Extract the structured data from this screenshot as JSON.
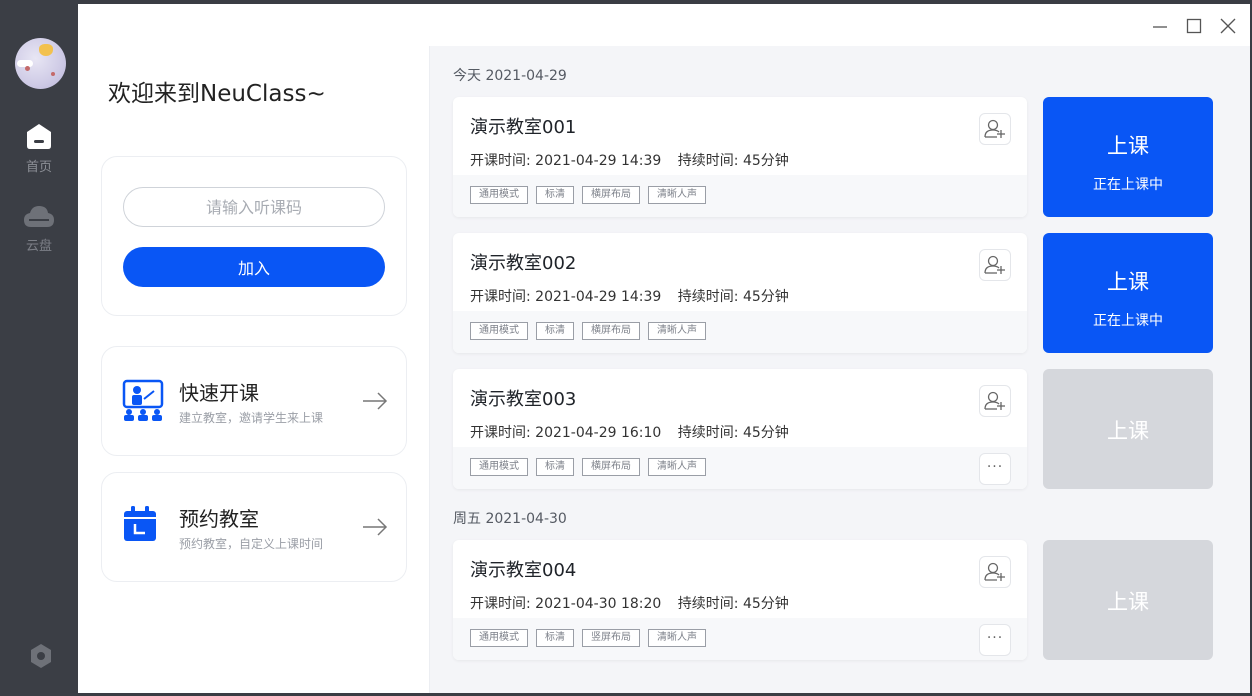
{
  "sidebar": {
    "items": [
      {
        "label": "首页",
        "icon": "home-icon"
      },
      {
        "label": "云盘",
        "icon": "cloud-icon"
      }
    ],
    "settings_icon": "settings-icon"
  },
  "welcome": "欢迎来到NeuClass~",
  "join": {
    "placeholder": "请输入听课码",
    "button": "加入"
  },
  "quick_start": {
    "title": "快速开课",
    "subtitle": "建立教室，邀请学生来上课"
  },
  "book_room": {
    "title": "预约教室",
    "subtitle": "预约教室，自定义上课时间"
  },
  "groups": [
    {
      "date": "今天 2021-04-29"
    },
    {
      "date": "周五 2021-04-30"
    }
  ],
  "rooms": [
    {
      "name": "演示教室001",
      "start_label": "开课时间:",
      "start": "2021-04-29 14:39",
      "duration_label": "持续时间:",
      "duration": "45分钟",
      "tags": [
        "通用模式",
        "标清",
        "横屏布局",
        "清晰人声"
      ],
      "button": "上课",
      "status": "正在上课中"
    },
    {
      "name": "演示教室002",
      "start_label": "开课时间:",
      "start": "2021-04-29 14:39",
      "duration_label": "持续时间:",
      "duration": "45分钟",
      "tags": [
        "通用模式",
        "标清",
        "横屏布局",
        "清晰人声"
      ],
      "button": "上课",
      "status": "正在上课中"
    },
    {
      "name": "演示教室003",
      "start_label": "开课时间:",
      "start": "2021-04-29 16:10",
      "duration_label": "持续时间:",
      "duration": "45分钟",
      "tags": [
        "通用模式",
        "标清",
        "横屏布局",
        "清晰人声"
      ],
      "button": "上课",
      "more": "···"
    },
    {
      "name": "演示教室004",
      "start_label": "开课时间:",
      "start": "2021-04-30 18:20",
      "duration_label": "持续时间:",
      "duration": "45分钟",
      "tags": [
        "通用模式",
        "标清",
        "竖屏布局",
        "清晰人声"
      ],
      "button": "上课",
      "more": "···"
    }
  ],
  "colors": {
    "accent": "#0956f5",
    "sidebar": "#3b3e45",
    "disabled": "#d5d7dc"
  }
}
